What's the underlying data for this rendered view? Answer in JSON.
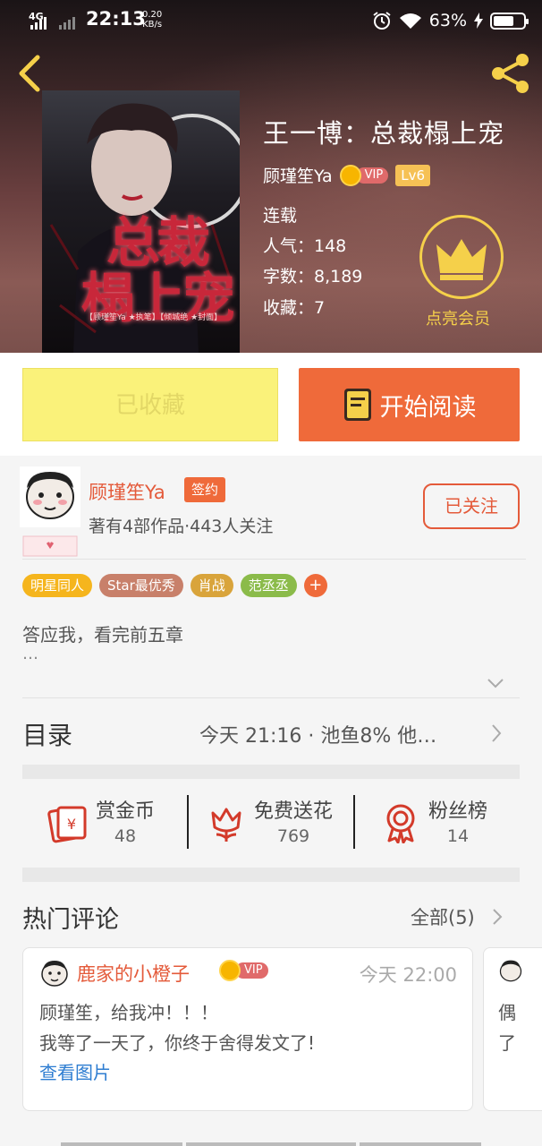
{
  "status_bar": {
    "network": "4G",
    "time": "22:13",
    "speed_value": "0.20",
    "speed_unit": "KB/s",
    "battery": "63%"
  },
  "book": {
    "title": "王一博：总裁榻上宠",
    "author": "顾瑾笙Ya",
    "vip_label": "VIP",
    "level": "Lv6",
    "status": "连载",
    "popularity_label": "人气：148",
    "words_label": "字数：8,189",
    "favorites_label": "收藏：7",
    "cover_title_line1": "总裁",
    "cover_title_line2": "榻上宠",
    "cover_small_text": "【顾瑾笙Ya ★执笔】【倾城绝 ★封面】"
  },
  "member": {
    "label": "点亮会员"
  },
  "actions": {
    "collected": "已收藏",
    "read": "开始阅读"
  },
  "author_card": {
    "name": "顾瑾笙Ya",
    "badge": "签约",
    "stats": "著有4部作品·443人关注",
    "follow": "已关注"
  },
  "tags": [
    {
      "label": "明星同人",
      "color": "#f5b51d"
    },
    {
      "label": "Star最优秀",
      "color": "#c8806a"
    },
    {
      "label": "肖战",
      "color": "#d9a43b"
    },
    {
      "label": "范丞丞",
      "color": "#8bbb4a"
    }
  ],
  "tag_add": "+",
  "description": {
    "text": "答应我，看完前五章",
    "more": "…"
  },
  "toc": {
    "label": "目录",
    "info": "今天 21:16 · 池鱼8%   他…"
  },
  "stats": [
    {
      "name": "赏金币",
      "value": "48",
      "icon": "coin-card-icon"
    },
    {
      "name": "免费送花",
      "value": "769",
      "icon": "flower-icon"
    },
    {
      "name": "粉丝榜",
      "value": "14",
      "icon": "medal-icon"
    }
  ],
  "hot_comments": {
    "title": "热门评论",
    "all_label": "全部(5)",
    "items": [
      {
        "user": "鹿家的小橙子",
        "vip": "VIP",
        "time": "今天 22:00",
        "line1": "顾瑾笙，给我冲！！！",
        "line2": "我等了一天了，你终于舍得发文了!",
        "link": "查看图片"
      },
      {
        "line1": "偶",
        "line2": "了"
      }
    ]
  }
}
